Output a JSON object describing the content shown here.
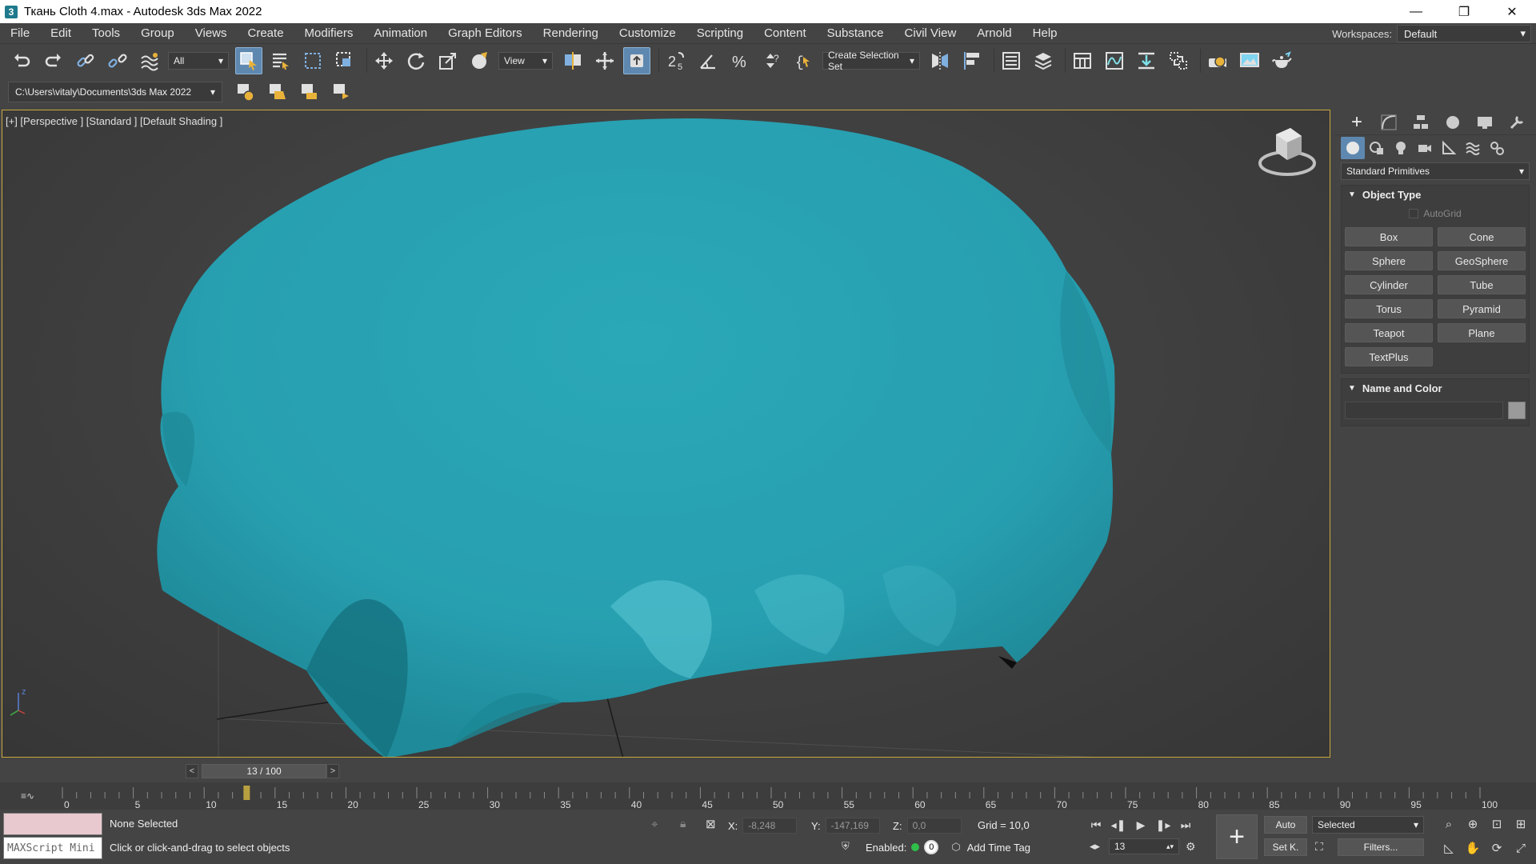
{
  "window": {
    "title": "Ткань Cloth 4.max - Autodesk 3ds Max 2022",
    "app_icon": "3",
    "minimize": "—",
    "restore": "❐",
    "close": "✕"
  },
  "menubar": {
    "items": [
      "File",
      "Edit",
      "Tools",
      "Group",
      "Views",
      "Create",
      "Modifiers",
      "Animation",
      "Graph Editors",
      "Rendering",
      "Customize",
      "Scripting",
      "Content",
      "Substance",
      "Civil View",
      "Arnold",
      "Help"
    ],
    "workspaces_label": "Workspaces:",
    "workspaces_value": "Default"
  },
  "toolbar": {
    "selection_filter": "All",
    "reference_coord": "View",
    "create_selection_set": "Create Selection Set"
  },
  "toolbar2": {
    "project_path": "C:\\Users\\vitaly\\Documents\\3ds Max 2022"
  },
  "viewport": {
    "label": "[+] [Perspective ] [Standard ] [Default Shading ]",
    "cloth_color": "#2aa8b8",
    "border_color": "#c8a83c"
  },
  "command_panel": {
    "category_dropdown": "Standard Primitives",
    "object_type": {
      "header": "Object Type",
      "autogrid": "AutoGrid",
      "buttons": [
        "Box",
        "Cone",
        "Sphere",
        "GeoSphere",
        "Cylinder",
        "Tube",
        "Torus",
        "Pyramid",
        "Teapot",
        "Plane",
        "TextPlus"
      ]
    },
    "name_and_color": {
      "header": "Name and Color"
    }
  },
  "time_slider": {
    "frame_display": "13 / 100",
    "prev": "<",
    "next": ">",
    "current_frame": 13,
    "total_frames": 100
  },
  "trackbar": {
    "tick_labels": [
      "0",
      "5",
      "10",
      "15",
      "20",
      "25",
      "30",
      "35",
      "40",
      "45",
      "50",
      "55",
      "60",
      "65",
      "70",
      "75",
      "80",
      "85",
      "90",
      "95",
      "100"
    ]
  },
  "status": {
    "maxscript_label": "MAXScript Mini",
    "selection_status": "None Selected",
    "prompt": "Click or click-and-drag to select objects",
    "x_label": "X:",
    "x_value": "-8,248",
    "y_label": "Y:",
    "y_value": "-147,169",
    "z_label": "Z:",
    "z_value": "0,0",
    "grid": "Grid = 10,0",
    "enabled_label": "Enabled:",
    "enabled_count": "0",
    "add_time_tag": "Add Time Tag",
    "frame_field": "13",
    "auto_key": "Auto",
    "set_key": "Set K.",
    "key_filter": "Selected",
    "filters": "Filters..."
  }
}
